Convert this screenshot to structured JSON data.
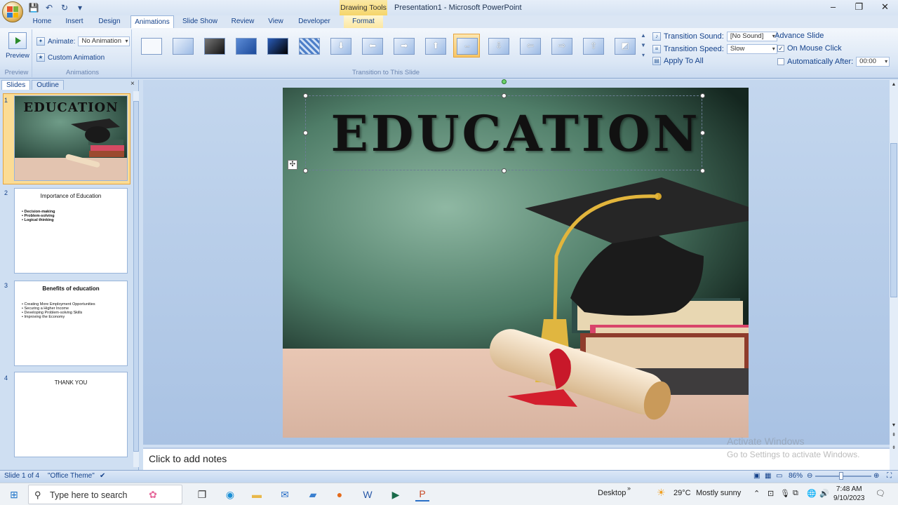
{
  "window": {
    "title": "Presentation1 - Microsoft PowerPoint",
    "contextual_label": "Drawing Tools",
    "controls": {
      "minimize": "–",
      "restore": "❐",
      "close": "✕"
    }
  },
  "tabs": [
    {
      "label": "Home"
    },
    {
      "label": "Insert"
    },
    {
      "label": "Design"
    },
    {
      "label": "Animations"
    },
    {
      "label": "Slide Show"
    },
    {
      "label": "Review"
    },
    {
      "label": "View"
    },
    {
      "label": "Developer"
    },
    {
      "label": "Format"
    }
  ],
  "ribbon": {
    "preview_group": {
      "button_label": "Preview",
      "group_label": "Preview"
    },
    "animations_group": {
      "animate_label": "Animate:",
      "animate_value": "No Animation",
      "custom_animation_label": "Custom Animation",
      "group_label": "Animations"
    },
    "transition_group": {
      "group_label": "Transition to This Slide",
      "sound_label": "Transition Sound:",
      "sound_value": "[No Sound]",
      "speed_label": "Transition Speed:",
      "speed_value": "Slow",
      "apply_all_label": "Apply To All"
    },
    "advance_group": {
      "title": "Advance Slide",
      "on_mouse_click_label": "On Mouse Click",
      "on_mouse_click_checked": true,
      "auto_after_label": "Automatically After:",
      "auto_after_checked": false,
      "auto_after_value": "00:00"
    }
  },
  "left_pane": {
    "tabs": [
      {
        "label": "Slides"
      },
      {
        "label": "Outline"
      }
    ],
    "close": "×",
    "slides": [
      {
        "number": "1",
        "title": "EDUCATION"
      },
      {
        "number": "2",
        "title": "Importance of Education",
        "bullets": [
          "Decision-making",
          "Problem-solving",
          "Logical thinking"
        ]
      },
      {
        "number": "3",
        "title": "Benefits of education",
        "bullets": [
          "Creating More Employment Opportunities",
          "Securing a Higher Income",
          "Developing Problem-solving Skills",
          "Improving the Economy"
        ]
      },
      {
        "number": "4",
        "title": "THANK YOU"
      }
    ]
  },
  "slide": {
    "title": "EDUCATION"
  },
  "notes": {
    "placeholder": "Click to add notes"
  },
  "watermark": {
    "line1": "Activate Windows",
    "line2": "Go to Settings to activate Windows."
  },
  "status_bar": {
    "slide_info": "Slide 1 of 4",
    "theme": "\"Office Theme\"",
    "zoom": "86%"
  },
  "taskbar": {
    "search_placeholder": "Type here to search",
    "desktop_label": "Desktop",
    "weather_temp": "29°C",
    "weather_text": "Mostly sunny",
    "time": "7:48 AM",
    "date": "9/10/2023"
  },
  "colors": {
    "ribbon_text": "#15428b",
    "selected_highlight": "#f6c462",
    "contextual_tab": "#f5d56a"
  }
}
